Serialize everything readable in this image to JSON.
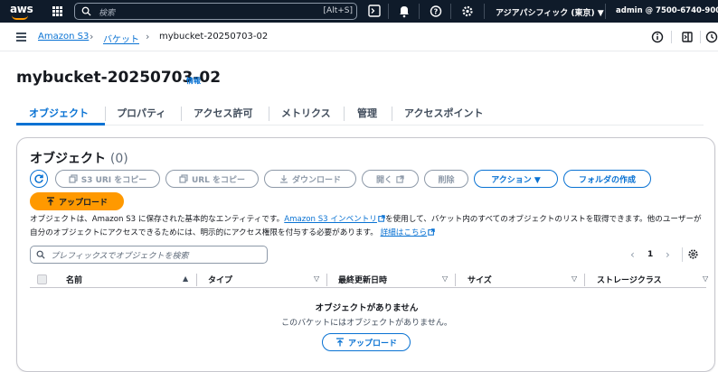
{
  "topnav": {
    "logo": "aws",
    "search_placeholder": "検索",
    "search_shortcut": "[Alt+S]",
    "region": "アジアパシフィック (東京) ▼",
    "account": "admin @ 7500-6740-9009 ▼",
    "icons": [
      "cloudshell-icon",
      "bell-icon",
      "help-icon",
      "gear-icon"
    ]
  },
  "breadcrumb": {
    "items": [
      "Amazon S3",
      "バケット",
      "mybucket-20250703-02"
    ]
  },
  "page": {
    "title": "mybucket-20250703-02",
    "info": "情報"
  },
  "tabs": [
    "オブジェクト",
    "プロパティ",
    "アクセス許可",
    "メトリクス",
    "管理",
    "アクセスポイント"
  ],
  "objects": {
    "title": "オブジェクト",
    "count": "(0)",
    "buttons": {
      "copy_s3_uri": "S3 URI をコピー",
      "copy_url": "URL をコピー",
      "download": "ダウンロード",
      "open": "開く",
      "delete": "削除",
      "actions": "アクション ▼",
      "create_folder": "フォルダの作成",
      "upload": "アップロード"
    },
    "description": {
      "part1": "オブジェクトは、Amazon S3 に保存された基本的なエンティティです。",
      "inventory_link": "Amazon S3 インベントリ",
      "part2": "を使用して、バケット内のすべてのオブジェクトのリストを取得できます。他のユーザーが自分のオブジェクトにアクセスできるためには、明示的にアクセス権限を付与する必要があります。",
      "learn_more": "詳細はこちら"
    },
    "filter_placeholder": "プレフィックスでオブジェクトを検索",
    "pager": {
      "prev": "‹",
      "page": "1",
      "next": "›"
    },
    "columns": [
      {
        "label": "名前",
        "sort": "▲"
      },
      {
        "label": "タイプ",
        "sort": "▽"
      },
      {
        "label": "最終更新日時",
        "sort": "▽"
      },
      {
        "label": "サイズ",
        "sort": "▽"
      },
      {
        "label": "ストレージクラス",
        "sort": "▽"
      }
    ],
    "empty": {
      "title": "オブジェクトがありません",
      "subtitle": "このバケットにはオブジェクトがありません。",
      "upload": "アップロード"
    }
  },
  "colors": {
    "nav_bg": "#0f1b2a",
    "link": "#0972d3",
    "primary_button": "#ff9900",
    "disabled": "#8d99a8"
  }
}
